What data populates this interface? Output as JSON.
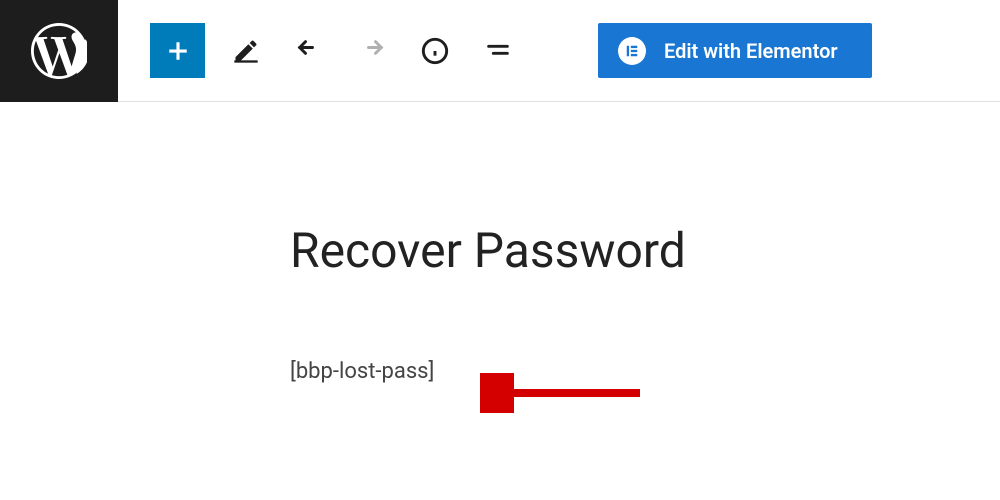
{
  "toolbar": {
    "elementor_label": "Edit with Elementor"
  },
  "content": {
    "title": "Recover Password",
    "shortcode": "[bbp-lost-pass]"
  }
}
